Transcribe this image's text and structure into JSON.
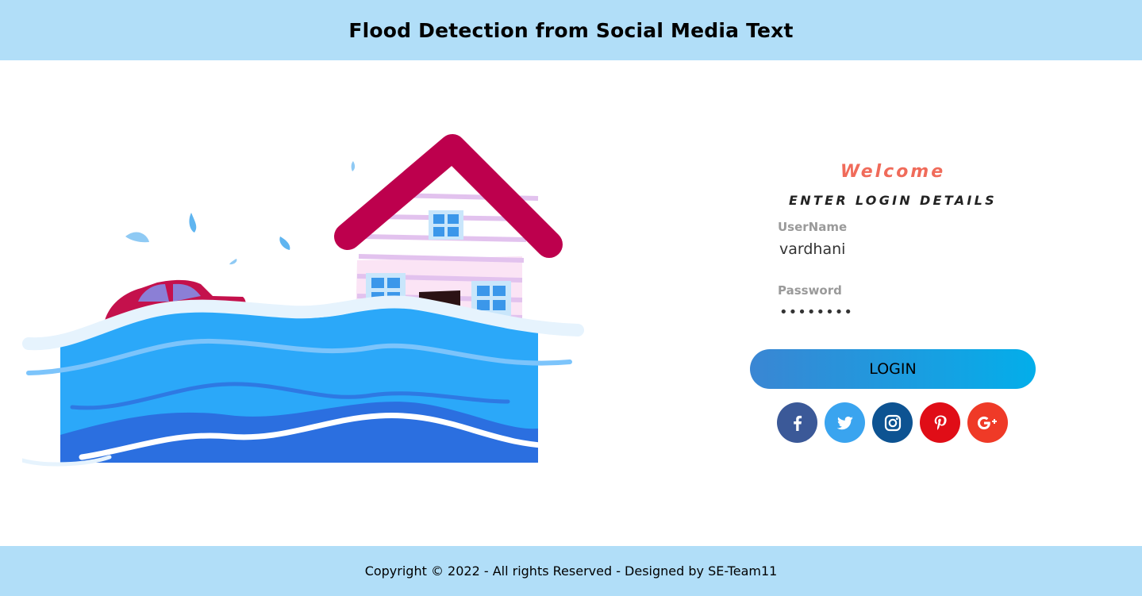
{
  "header": {
    "title": "Flood Detection from Social Media Text"
  },
  "login": {
    "welcome": "Welcome",
    "subtitle": "ENTER LOGIN DETAILS",
    "username_label": "UserName",
    "username_value": "vardhani",
    "password_label": "Password",
    "password_value": "********",
    "login_button": "LOGIN"
  },
  "social": [
    {
      "icon": "facebook-icon",
      "color": "#3b5998"
    },
    {
      "icon": "twitter-icon",
      "color": "#3aa4ef"
    },
    {
      "icon": "instagram-icon",
      "color": "#0d5392"
    },
    {
      "icon": "pinterest-icon",
      "color": "#e00d17"
    },
    {
      "icon": "google-plus-icon",
      "color": "#ef3a27"
    }
  ],
  "footer": {
    "copyright": "Copyright © 2022 - All rights Reserved - Designed by SE-Team11"
  },
  "colors": {
    "header_bg": "#b1def8",
    "welcome": "#f06b5a",
    "button_gradient_start": "#3a86d3",
    "button_gradient_end": "#03aeea"
  }
}
